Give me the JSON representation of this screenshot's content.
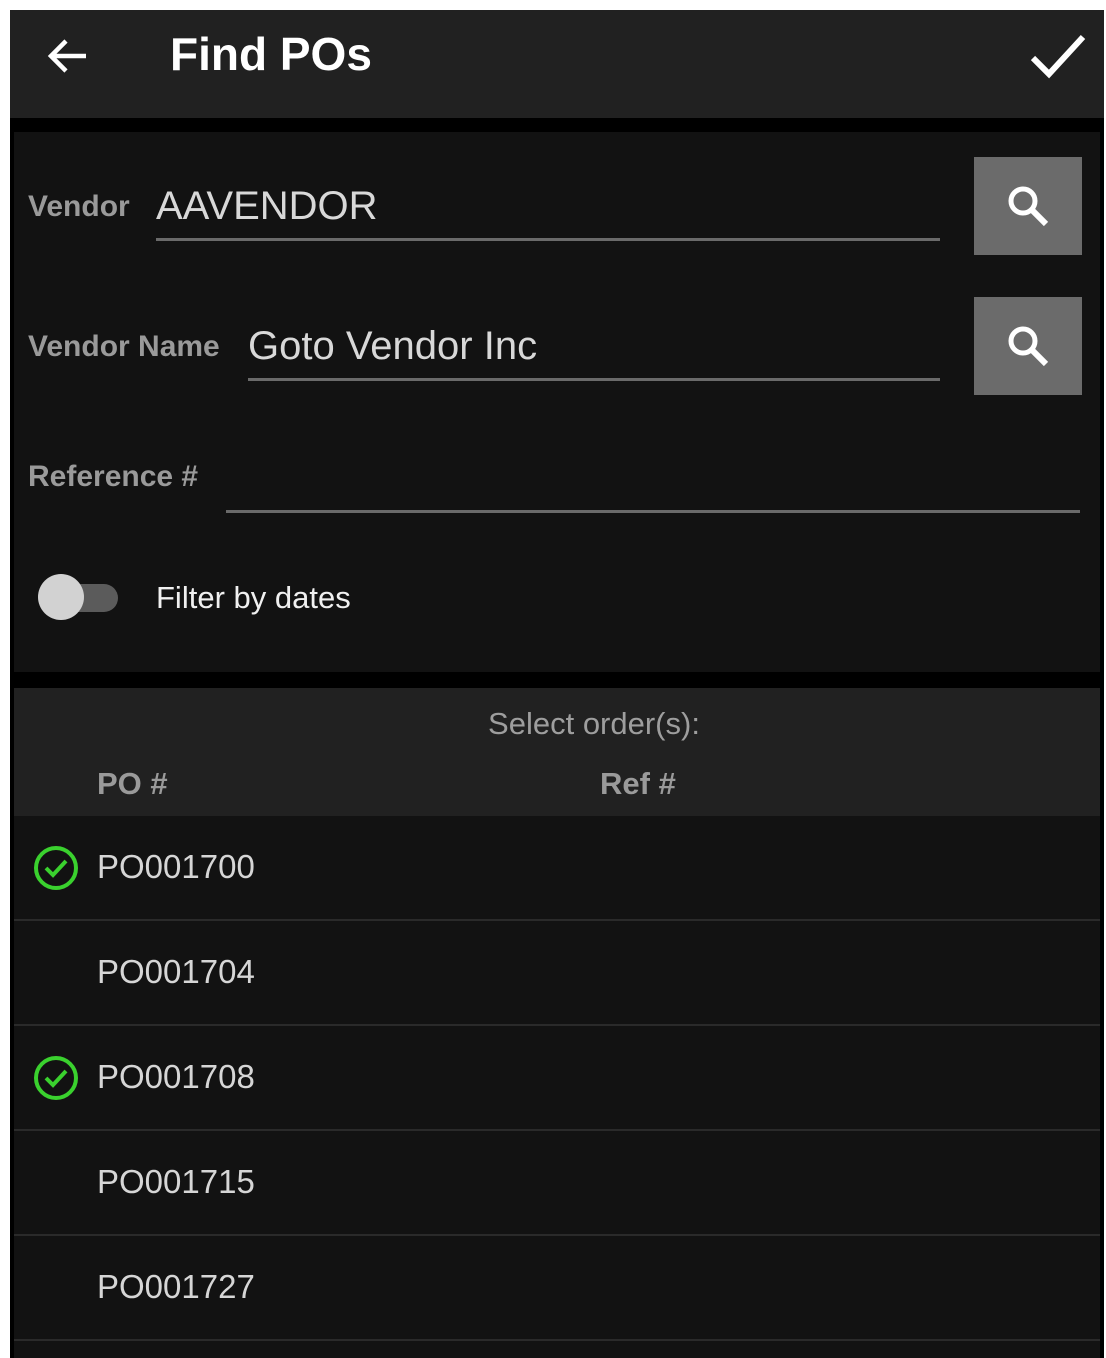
{
  "appbar": {
    "title": "Find POs",
    "back_icon": "arrow-left-icon",
    "confirm_icon": "checkmark-icon"
  },
  "form": {
    "vendor": {
      "label": "Vendor",
      "value": "AAVENDOR"
    },
    "vendor_name": {
      "label": "Vendor Name",
      "value": "Goto Vendor Inc"
    },
    "reference": {
      "label": "Reference #",
      "value": ""
    },
    "filter_dates": {
      "label": "Filter by dates",
      "on": false
    }
  },
  "list": {
    "caption": "Select order(s):",
    "columns": [
      "PO #",
      "Ref #"
    ],
    "rows": [
      {
        "po": "PO001700",
        "ref": "",
        "selected": true
      },
      {
        "po": "PO001704",
        "ref": "",
        "selected": false
      },
      {
        "po": "PO001708",
        "ref": "",
        "selected": true
      },
      {
        "po": "PO001715",
        "ref": "",
        "selected": false
      },
      {
        "po": "PO001727",
        "ref": "",
        "selected": false
      }
    ]
  },
  "colors": {
    "accent_selected": "#3ad12e",
    "appbar_bg": "#212121",
    "panel_bg": "#121212",
    "search_button_bg": "#6b6b6b"
  }
}
